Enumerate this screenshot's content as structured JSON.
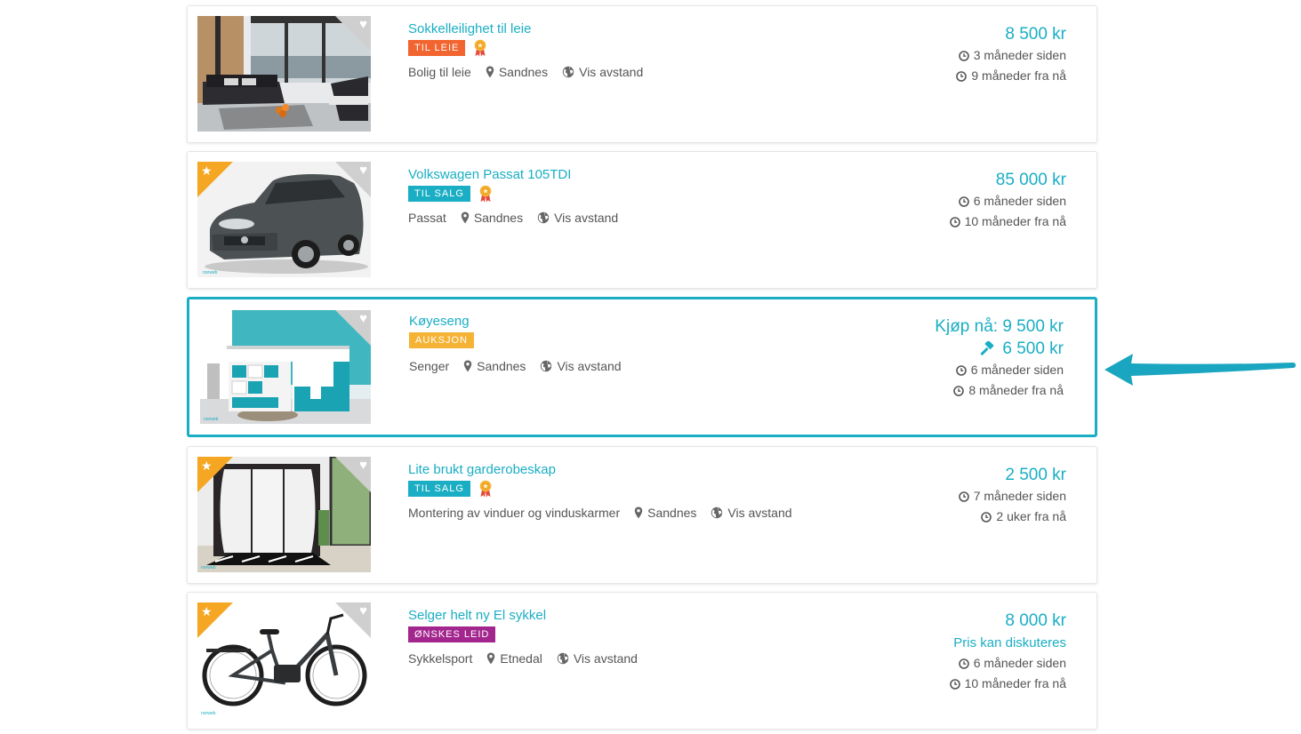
{
  "listings": [
    {
      "title": "Sokkelleilighet til leie",
      "badge": "TIL LEIE",
      "badge_color": "#f26430",
      "has_medal": true,
      "featured": false,
      "category": "Bolig til leie",
      "location": "Sandnes",
      "distance_link": "Vis avstand",
      "price": "8 500 kr",
      "posted": "3 måneder siden",
      "expires": "9 måneder fra nå"
    },
    {
      "title": "Volkswagen Passat 105TDI",
      "badge": "TIL SALG",
      "badge_color": "#1aaec4",
      "has_medal": true,
      "featured": true,
      "category": "Passat",
      "location": "Sandnes",
      "distance_link": "Vis avstand",
      "price": "85 000 kr",
      "posted": "6 måneder siden",
      "expires": "10 måneder fra nå"
    },
    {
      "title": "Køyeseng",
      "badge": "AUKSJON",
      "badge_color": "#f5b335",
      "has_medal": false,
      "featured": false,
      "category": "Senger",
      "location": "Sandnes",
      "distance_link": "Vis avstand",
      "buy_now": "Kjøp nå: 9 500 kr",
      "bid": "6 500 kr",
      "posted": "6 måneder siden",
      "expires": "8 måneder fra nå"
    },
    {
      "title": "Lite brukt garderobeskap",
      "badge": "TIL SALG",
      "badge_color": "#1aaec4",
      "has_medal": true,
      "featured": true,
      "category": "Montering av vinduer og vinduskarmer",
      "location": "Sandnes",
      "distance_link": "Vis avstand",
      "price": "2 500 kr",
      "posted": "7 måneder siden",
      "expires": "2 uker fra nå"
    },
    {
      "title": "Selger helt ny El sykkel",
      "badge": "ØNSKES LEID",
      "badge_color": "#a3268e",
      "has_medal": false,
      "featured": true,
      "category": "Sykkelsport",
      "location": "Etnedal",
      "distance_link": "Vis avstand",
      "price": "8 000 kr",
      "negotiable": "Pris kan diskuteres",
      "posted": "6 måneder siden",
      "expires": "10 måneder fra nå"
    }
  ],
  "icons": {
    "favorite": "heart-icon",
    "featured": "star-icon",
    "location": "map-marker-icon",
    "distance": "globe-icon",
    "time": "clock-icon",
    "bid": "gavel-icon",
    "medal": "award-medal-icon"
  },
  "accent_color": "#1aaec4",
  "annotation_color": "#1aa6c0"
}
